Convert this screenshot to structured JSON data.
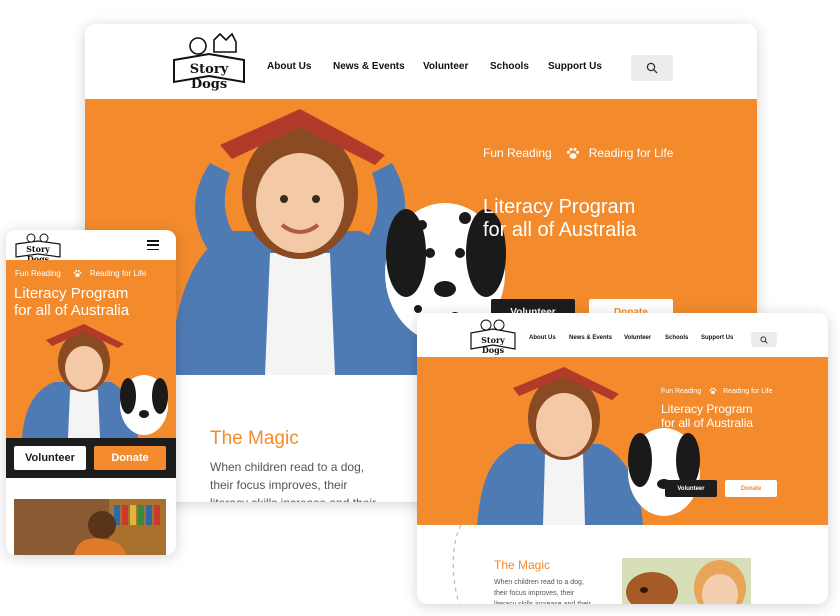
{
  "brand": {
    "logo_text": "Story Dogs"
  },
  "nav": {
    "items": [
      "About Us",
      "News & Events",
      "Volunteer",
      "Schools",
      "Support Us"
    ]
  },
  "hero": {
    "tag_left": "Fun Reading",
    "tag_right": "Reading for Life",
    "headline_line1": "Literacy Program",
    "headline_line2": "for all of Australia",
    "volunteer_label": "Volunteer",
    "donate_label": "Donate"
  },
  "magic": {
    "title": "The Magic",
    "text": "When children read to a dog, their focus improves, their literacy skills increase and their"
  },
  "colors": {
    "accent": "#f38b2c",
    "dark": "#1d1d1d"
  },
  "icons": [
    "search-icon",
    "paw-icon",
    "hamburger-menu-icon"
  ]
}
